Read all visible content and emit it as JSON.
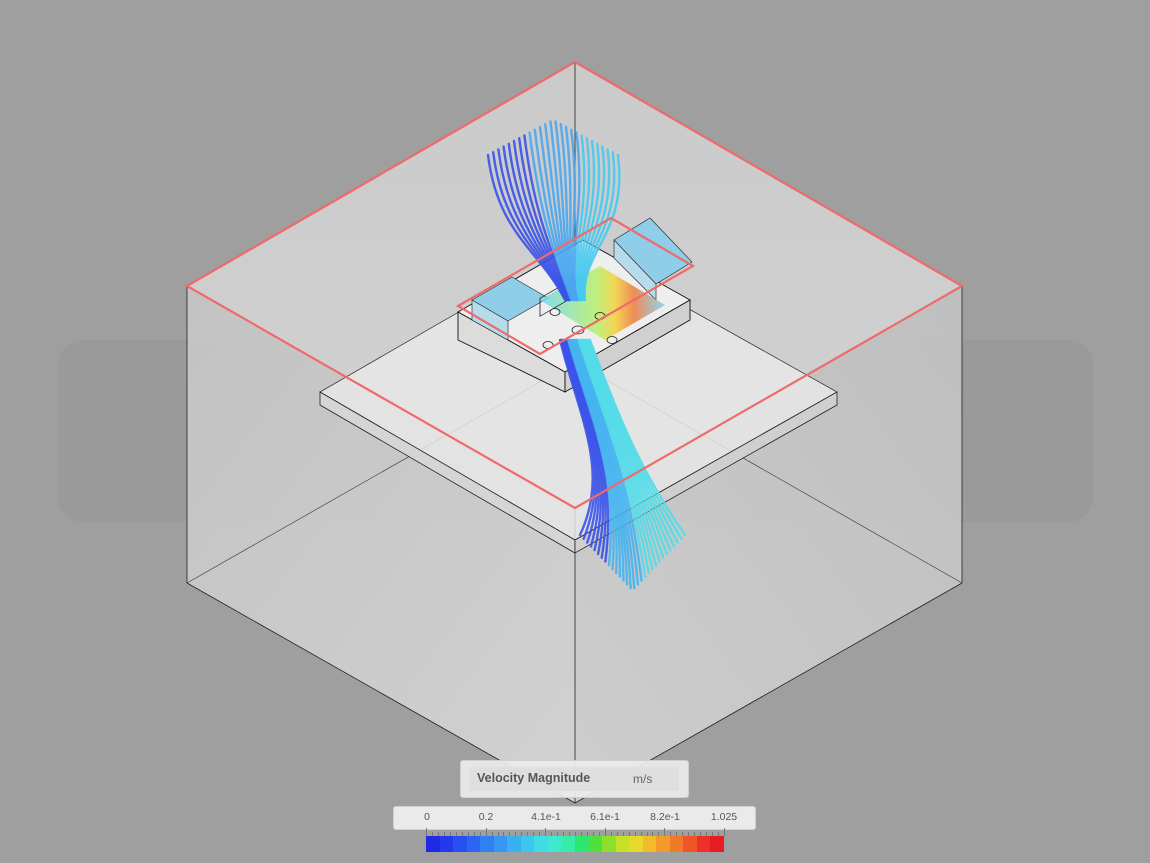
{
  "legend": {
    "title": "Velocity Magnitude",
    "unit": "m/s",
    "ticks": [
      "0",
      "0.2",
      "4.1e-1",
      "6.1e-1",
      "8.2e-1",
      "1.025"
    ],
    "colors": [
      "#2229e6",
      "#2438ee",
      "#2750f0",
      "#2b66f2",
      "#3180f2",
      "#3797f2",
      "#3bb0f0",
      "#3ec7ee",
      "#3fdbe6",
      "#3de9d0",
      "#37eca5",
      "#2fe770",
      "#4fe03c",
      "#8edf2c",
      "#c8e02a",
      "#e9d82a",
      "#f1bb2a",
      "#f39b29",
      "#f27928",
      "#ef5528",
      "#ea3326",
      "#e41d22"
    ]
  },
  "colors": {
    "background": "#9f9f9f",
    "domain_highlight": "#ef6a6a",
    "streamline_low": "#3a4ce8",
    "streamline_high": "#4fe0e8"
  }
}
